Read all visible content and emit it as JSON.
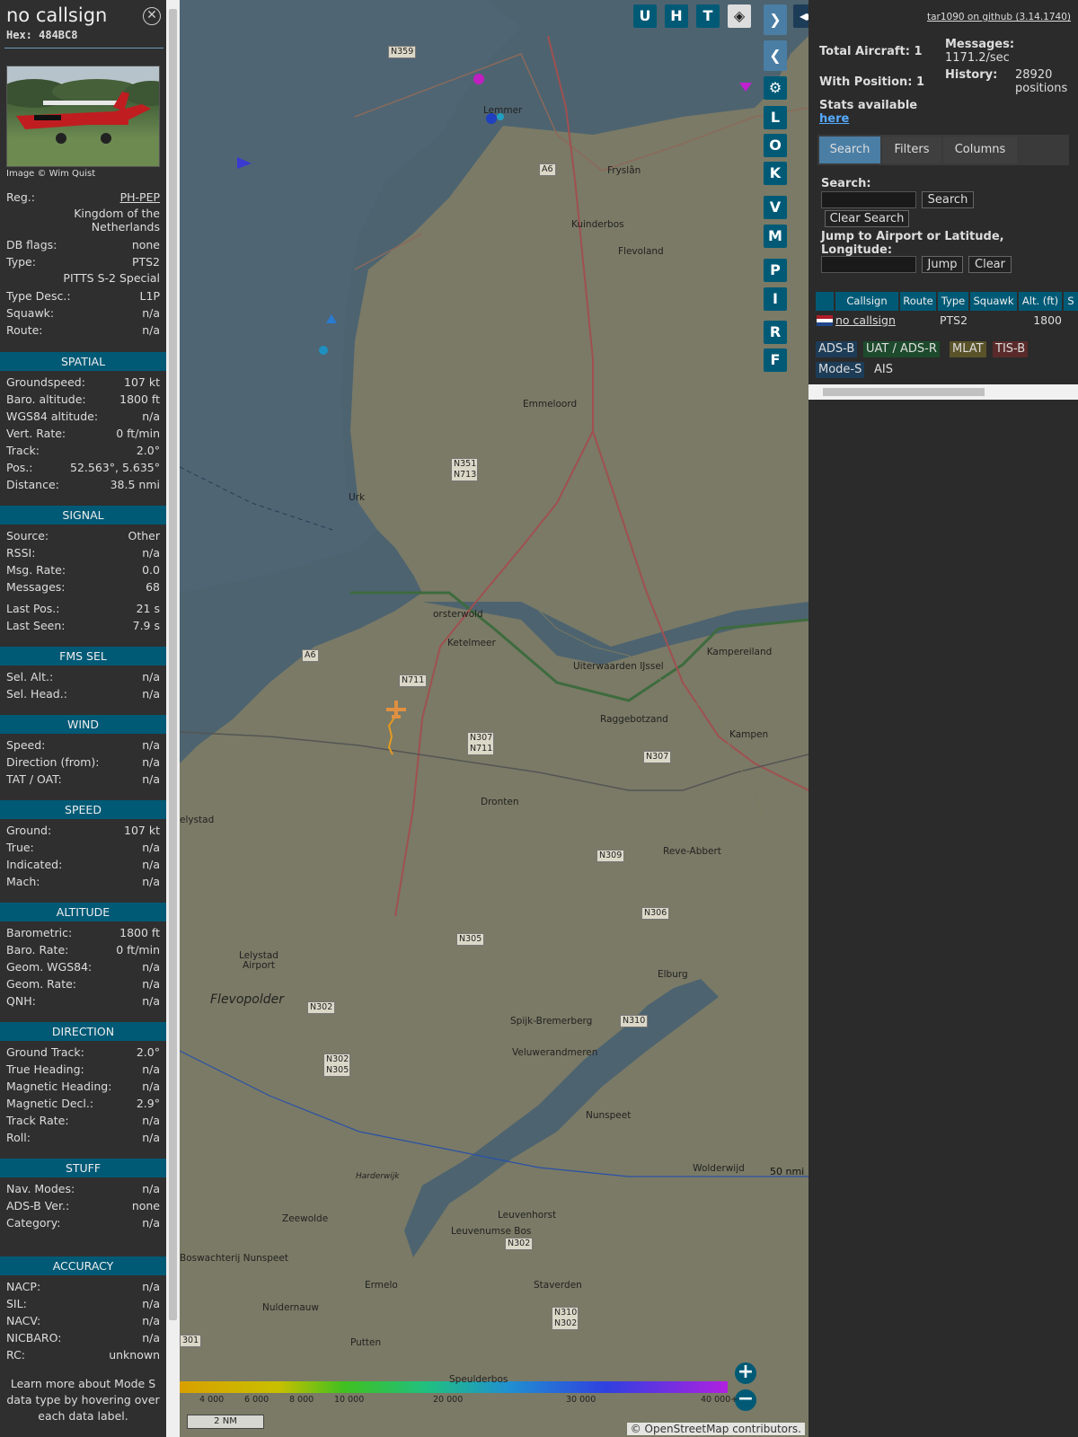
{
  "panel": {
    "title": "no callsign",
    "hex": "Hex: 484BC8",
    "image_credit": "Image © Wim Quist",
    "info": [
      {
        "k": "Reg.:",
        "v": "PH-PEP"
      },
      {
        "k": "",
        "v": "Kingdom of the Netherlands"
      },
      {
        "k": "DB flags:",
        "v": "none"
      },
      {
        "k": "Type:",
        "v": "PTS2"
      },
      {
        "k": "",
        "v": "PITTS S-2 Special"
      },
      {
        "k": "Type Desc.:",
        "v": "L1P"
      },
      {
        "k": "Squawk:",
        "v": "n/a"
      },
      {
        "k": "Route:",
        "v": "n/a"
      }
    ],
    "sections": [
      {
        "title": "SPATIAL",
        "rows": [
          {
            "k": "Groundspeed:",
            "v": "107 kt"
          },
          {
            "k": "Baro. altitude:",
            "v": "1800 ft"
          },
          {
            "k": "WGS84 altitude:",
            "v": "n/a"
          },
          {
            "k": "Vert. Rate:",
            "v": "0 ft/min"
          },
          {
            "k": "Track:",
            "v": "2.0°"
          },
          {
            "k": "Pos.:",
            "v": "52.563°, 5.635°"
          },
          {
            "k": "Distance:",
            "v": "38.5 nmi"
          }
        ]
      },
      {
        "title": "SIGNAL",
        "rows": [
          {
            "k": "Source:",
            "v": "Other"
          },
          {
            "k": "RSSI:",
            "v": "n/a"
          },
          {
            "k": "Msg. Rate:",
            "v": "0.0"
          },
          {
            "k": "Messages:",
            "v": "68"
          },
          {
            "k": "Last Pos.:",
            "v": "21 s"
          },
          {
            "k": "Last Seen:",
            "v": "7.9 s"
          }
        ]
      },
      {
        "title": "FMS SEL",
        "rows": [
          {
            "k": "Sel. Alt.:",
            "v": "n/a"
          },
          {
            "k": "Sel. Head.:",
            "v": "n/a"
          }
        ]
      },
      {
        "title": "WIND",
        "rows": [
          {
            "k": "Speed:",
            "v": "n/a"
          },
          {
            "k": "Direction (from):",
            "v": "n/a"
          },
          {
            "k": "TAT / OAT:",
            "v": "n/a"
          }
        ]
      },
      {
        "title": "SPEED",
        "rows": [
          {
            "k": "Ground:",
            "v": "107 kt"
          },
          {
            "k": "True:",
            "v": "n/a"
          },
          {
            "k": "Indicated:",
            "v": "n/a"
          },
          {
            "k": "Mach:",
            "v": "n/a"
          }
        ]
      },
      {
        "title": "ALTITUDE",
        "rows": [
          {
            "k": "Barometric:",
            "v": "1800 ft"
          },
          {
            "k": "Baro. Rate:",
            "v": "0 ft/min"
          },
          {
            "k": "Geom. WGS84:",
            "v": "n/a"
          },
          {
            "k": "Geom. Rate:",
            "v": "n/a"
          },
          {
            "k": "QNH:",
            "v": "n/a"
          }
        ]
      },
      {
        "title": "DIRECTION",
        "rows": [
          {
            "k": "Ground Track:",
            "v": "2.0°"
          },
          {
            "k": "True Heading:",
            "v": "n/a"
          },
          {
            "k": "Magnetic Heading:",
            "v": "n/a"
          },
          {
            "k": "Magnetic Decl.:",
            "v": "2.9°"
          },
          {
            "k": "Track Rate:",
            "v": "n/a"
          },
          {
            "k": "Roll:",
            "v": "n/a"
          }
        ]
      },
      {
        "title": "STUFF",
        "rows": [
          {
            "k": "Nav. Modes:",
            "v": "n/a"
          },
          {
            "k": "ADS-B Ver.:",
            "v": "none"
          },
          {
            "k": "Category:",
            "v": "n/a"
          }
        ]
      },
      {
        "title": "ACCURACY",
        "rows": [
          {
            "k": "NACP:",
            "v": "n/a"
          },
          {
            "k": "SIL:",
            "v": "n/a"
          },
          {
            "k": "NACV:",
            "v": "n/a"
          },
          {
            "k": "NICBARO:",
            "v": "n/a"
          },
          {
            "k": "RC:",
            "v": "unknown"
          }
        ]
      }
    ],
    "learn_more": "Learn more about Mode S data type by hovering over each data label."
  },
  "map": {
    "buttons_top": [
      "U",
      "H",
      "T"
    ],
    "buttons_side": [
      "L",
      "O",
      "K",
      "V",
      "M",
      "P",
      "I",
      "R",
      "F"
    ],
    "places": [
      "Lemmer",
      "Emmeloord",
      "Urk",
      "Ketelmeer",
      "Uiterwaarden IJssel",
      "Kampereiland",
      "Raggebotzand",
      "Kampen",
      "Dronten",
      "elystad",
      "Reve-Abbert",
      "Elburg",
      "Lelystad Airport",
      "Flevopolder",
      "Spijk-Bremerberg",
      "Veluwerandmeren",
      "Nunspeet",
      "Harderwijk",
      "Zeewolde",
      "Leuvenhorst",
      "Leuvenumse Bos",
      "Staverden",
      "Ermelo",
      "Putten",
      "Speulderbos",
      "Kuinderbos",
      "Flevoland",
      "Fryslân",
      "Nuldernauw",
      "Wolderwijd",
      "Boswachterij Nunspeet",
      "orsterwold",
      "Flevoland"
    ],
    "roads": [
      "N359",
      "A6",
      "N351 N713",
      "A6",
      "N711",
      "N307 N711",
      "N307",
      "N309",
      "N306",
      "N305",
      "N302",
      "N302 N305",
      "N310",
      "N302",
      "N310 N302",
      "301"
    ],
    "alt_scale": [
      "4 000",
      "6 000",
      "8 000",
      "10 000",
      "20 000",
      "30 000",
      "40 000+"
    ],
    "scale_label": "2 NM",
    "range_label": "50 nmi",
    "copyright": "© OpenStreetMap contributors."
  },
  "side": {
    "github": "tar1090 on github (3.14.1740)",
    "total_aircraft": "Total Aircraft: 1",
    "with_position": "With Position: 1",
    "messages_label": "Messages:",
    "messages_value": "1171.2/sec",
    "history_label": "History:",
    "history_value": "28920 positions",
    "stats_text": "Stats available",
    "stats_link": "here",
    "tabs": [
      "Search",
      "Filters",
      "Columns"
    ],
    "search_label": "Search:",
    "search_btn": "Search",
    "clear_search_btn": "Clear Search",
    "jump_label": "Jump to Airport or Latitude, Longitude:",
    "jump_btn": "Jump",
    "clear_btn": "Clear",
    "table_headers": [
      "Callsign",
      "Route",
      "Type",
      "Squawk",
      "Alt. (ft)",
      "S"
    ],
    "table_row": {
      "callsign": "no callsign",
      "route": "",
      "type": "PTS2",
      "squawk": "",
      "alt": "1800"
    },
    "legend": [
      "ADS-B",
      "UAT / ADS-R",
      "MLAT",
      "TIS-B",
      "Mode-S",
      "AIS"
    ]
  },
  "colors": {
    "accent": "#005a76",
    "adsb": "#1d3c57",
    "uat": "#1d4a2c",
    "mlat": "#5a5228",
    "tisb": "#5a2a2a",
    "modes": "#1d3c57"
  }
}
